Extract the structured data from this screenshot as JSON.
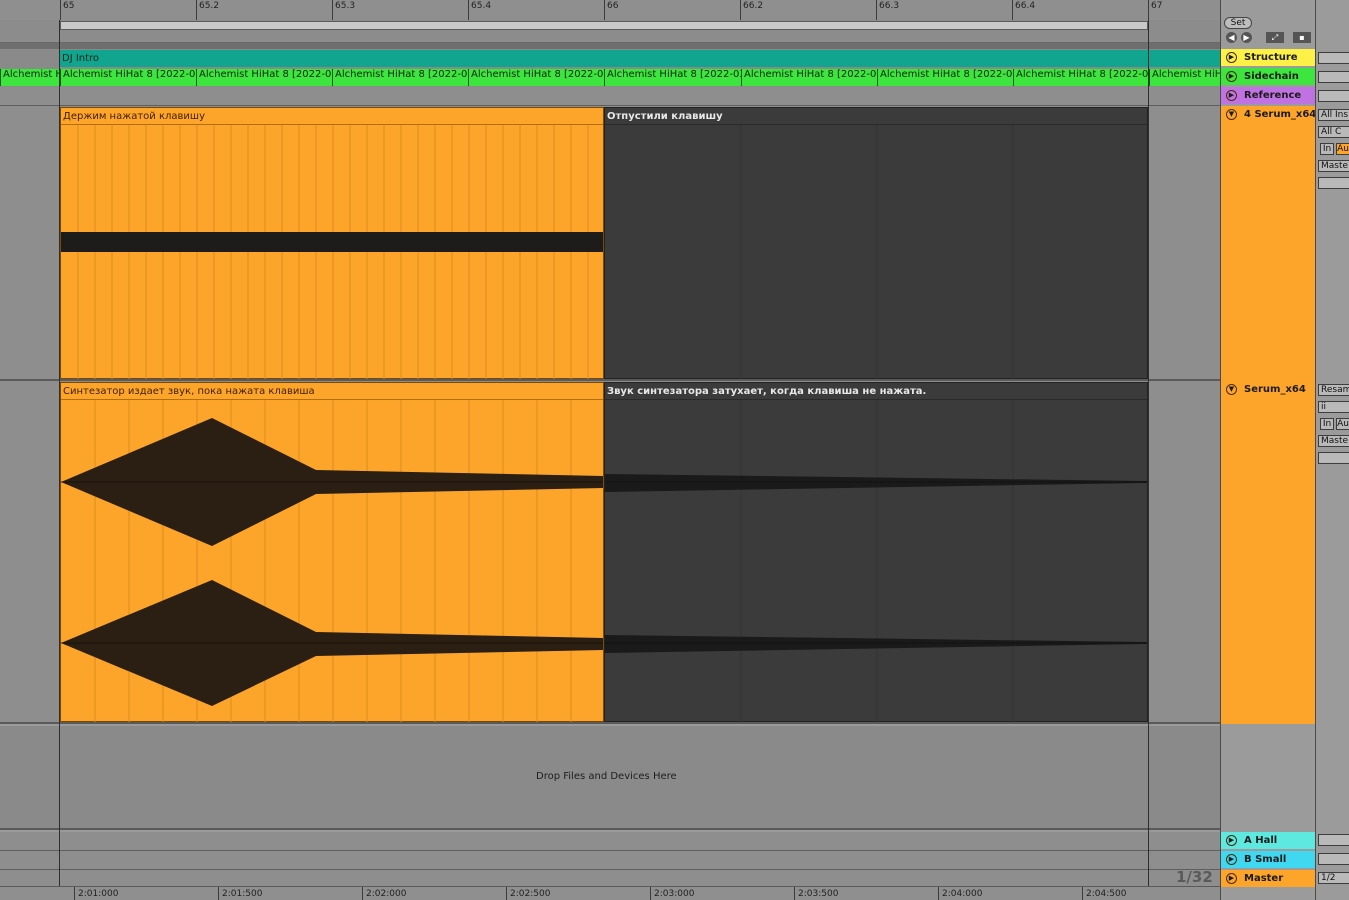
{
  "ruler": {
    "bars": [
      "65",
      "65.2",
      "65.3",
      "65.4",
      "66",
      "66.2",
      "66.3",
      "66.4",
      "67"
    ]
  },
  "arrangement": {
    "structure_clip": "DJ Intro",
    "hihat_clips": [
      "Alchemist H",
      "Alchemist HiHat 8 [2022-03",
      "Alchemist HiHat 8 [2022-03",
      "Alchemist HiHat 8 [2022-03",
      "Alchemist HiHat 8 [2022-03",
      "Alchemist HiHat 8 [2022-03",
      "Alchemist HiHat 8 [2022-03",
      "Alchemist HiHat 8 [2022-03",
      "Alchemist HiHat 8 [2022-03",
      "Alchemist HiH"
    ],
    "midi_held_clip": "Держим нажатой клавишу",
    "midi_release_clip": "Отпустили клавишу",
    "audio_held_clip": "Синтезатор издает звук, пока нажата клавиша",
    "audio_release_clip": "Звук синтезатора затухает, когда клавиша не нажата.",
    "drop_zone": "Drop Files and Devices Here"
  },
  "tracks": [
    {
      "name": "Structure",
      "color": "#fdf046"
    },
    {
      "name": "Sidechain",
      "color": "#3ee53e"
    },
    {
      "name": "Reference",
      "color": "#c072e2"
    },
    {
      "name": "4 Serum_x64",
      "color": "#fda52b"
    },
    {
      "name": "Serum_x64",
      "color": "#fda52b"
    },
    {
      "name": "A Hall",
      "color": "#5de8e0"
    },
    {
      "name": "B Small",
      "color": "#3fd8f0"
    },
    {
      "name": "Master",
      "color": "#fda52b"
    }
  ],
  "header": {
    "set_label": "Set",
    "zoom_label": "1/32"
  },
  "io": {
    "midi_from": "All Ins",
    "midi_channel": "All C",
    "monitor_in": "In",
    "monitor_auto": "Au",
    "midi_to": "Maste",
    "audio_from": "Resam",
    "audio_channel": "ii",
    "audio_monitor_in": "In",
    "audio_monitor_auto": "Au",
    "audio_to": "Maste",
    "master_out": "1/2"
  },
  "timeline": {
    "times": [
      "2:01:000",
      "2:01:500",
      "2:02:000",
      "2:02:500",
      "2:03:000",
      "2:03:500",
      "2:04:000",
      "2:04:500"
    ]
  },
  "colors": {
    "midi_clip": "#fda52b",
    "hihat_clip": "#3ee53e",
    "structure_clip": "#11a48e",
    "release_clip": "#3b3b3b"
  }
}
